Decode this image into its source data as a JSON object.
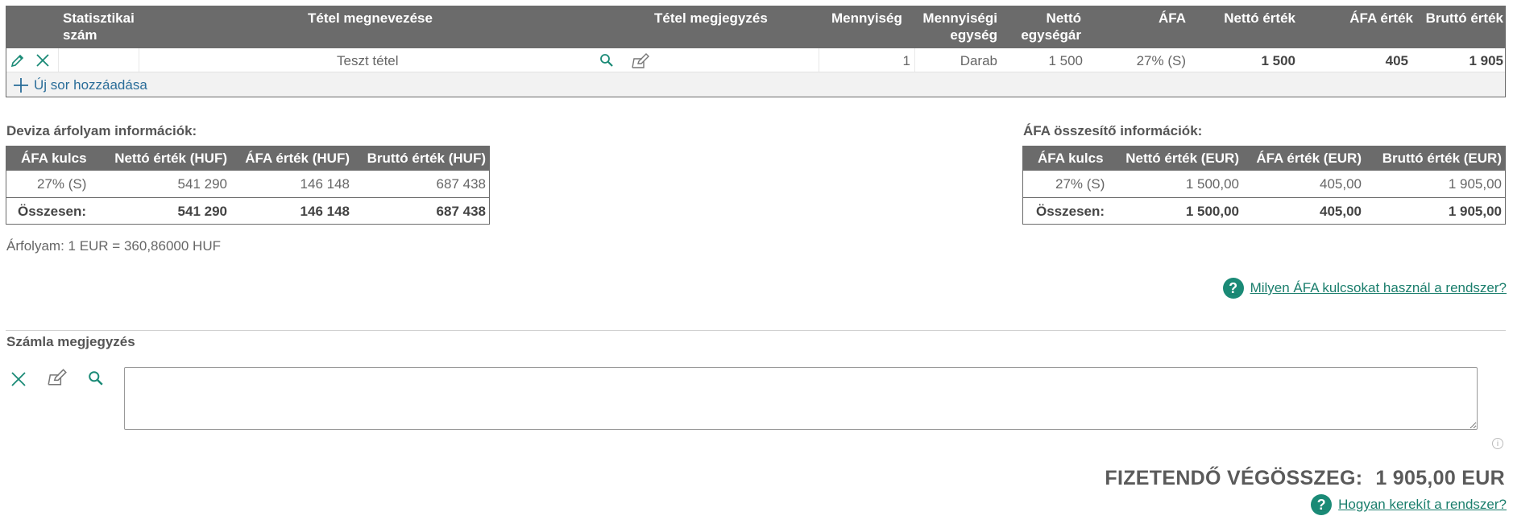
{
  "items_table": {
    "headers": {
      "stat_num": "Statisztikai szám",
      "item_name": "Tétel megnevezése",
      "item_note": "Tétel megjegyzés",
      "quantity": "Mennyiség",
      "unit": "Mennyiségi egység",
      "net_unit_price": "Nettó egységár",
      "vat": "ÁFA",
      "net_value": "Nettó érték",
      "vat_value": "ÁFA érték",
      "gross_value": "Bruttó érték"
    },
    "rows": [
      {
        "stat_num": "",
        "item_name": "Teszt tétel",
        "item_note": "",
        "quantity": "1",
        "unit": "Darab",
        "net_unit_price": "1 500",
        "vat": "27% (S)",
        "net_value": "1 500",
        "vat_value": "405",
        "gross_value": "1 905"
      }
    ],
    "add_row_label": "Új sor hozzáadása"
  },
  "currency_info": {
    "title": "Deviza árfolyam információk:",
    "headers": [
      "ÁFA kulcs",
      "Nettó érték (HUF)",
      "ÁFA érték (HUF)",
      "Bruttó érték (HUF)"
    ],
    "row": [
      "27% (S)",
      "541 290",
      "146 148",
      "687 438"
    ],
    "total": [
      "Összesen:",
      "541 290",
      "146 148",
      "687 438"
    ],
    "rate_text": "Árfolyam: 1 EUR = 360,86000 HUF"
  },
  "vat_summary": {
    "title": "ÁFA összesítő információk:",
    "headers": [
      "ÁFA kulcs",
      "Nettó érték (EUR)",
      "ÁFA érték (EUR)",
      "Bruttó érték (EUR)"
    ],
    "row": [
      "27% (S)",
      "1 500,00",
      "405,00",
      "1 905,00"
    ],
    "total": [
      "Összesen:",
      "1 500,00",
      "405,00",
      "1 905,00"
    ]
  },
  "help_links": {
    "vat_rates": "Milyen ÁFA kulcsokat használ a rendszer?",
    "rounding": "Hogyan kerekít a rendszer?"
  },
  "invoice_note": {
    "title": "Számla megjegyzés",
    "value": ""
  },
  "grand_total": {
    "label": "FIZETENDŐ VÉGÖSSZEG:",
    "value": "1 905,00 EUR"
  },
  "icons": [
    "pencil-icon",
    "close-icon",
    "search-icon",
    "note-edit-icon",
    "plus-icon",
    "help-icon",
    "info-icon"
  ],
  "colors": {
    "header_bg": "#6b6b6b",
    "accent_teal": "#1a8a76",
    "link_blue": "#2a6d99"
  }
}
